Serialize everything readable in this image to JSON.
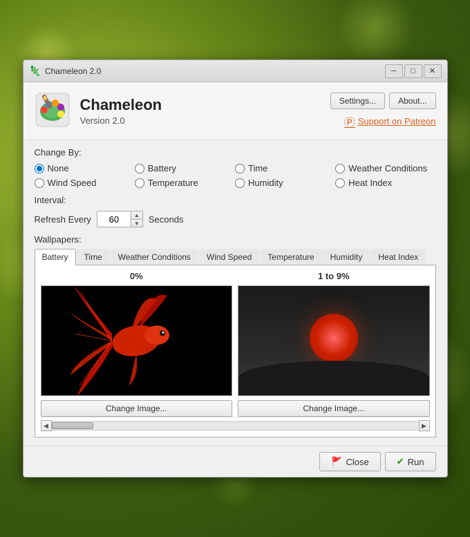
{
  "window": {
    "title": "Chameleon 2.0",
    "controls": {
      "minimize": "─",
      "maximize": "□",
      "close": "✕"
    }
  },
  "header": {
    "app_name": "Chameleon",
    "version": "Version 2.0",
    "settings_btn": "Settings...",
    "about_btn": "About...",
    "patreon_text": "Support on Patreon"
  },
  "change_by": {
    "label": "Change By:",
    "options": [
      {
        "id": "none",
        "label": "None",
        "checked": true
      },
      {
        "id": "battery",
        "label": "Battery",
        "checked": false
      },
      {
        "id": "time",
        "label": "Time",
        "checked": false
      },
      {
        "id": "weather",
        "label": "Weather Conditions",
        "checked": false
      },
      {
        "id": "wind",
        "label": "Wind Speed",
        "checked": false
      },
      {
        "id": "temperature",
        "label": "Temperature",
        "checked": false
      },
      {
        "id": "humidity",
        "label": "Humidity",
        "checked": false
      },
      {
        "id": "heat",
        "label": "Heat Index",
        "checked": false
      }
    ]
  },
  "interval": {
    "label": "Interval:",
    "refresh_label": "Refresh Every",
    "value": "60",
    "unit": "Seconds"
  },
  "wallpapers": {
    "label": "Wallpapers:",
    "tabs": [
      {
        "id": "battery",
        "label": "Battery",
        "active": true
      },
      {
        "id": "time",
        "label": "Time",
        "active": false
      },
      {
        "id": "weather",
        "label": "Weather Conditions",
        "active": false
      },
      {
        "id": "wind",
        "label": "Wind Speed",
        "active": false
      },
      {
        "id": "temperature",
        "label": "Temperature",
        "active": false
      },
      {
        "id": "humidity",
        "label": "Humidity",
        "active": false
      },
      {
        "id": "heat",
        "label": "Heat Index",
        "active": false
      }
    ],
    "cards": [
      {
        "title": "0%",
        "change_btn": "Change Image..."
      },
      {
        "title": "1 to 9%",
        "change_btn": "Change Image..."
      }
    ]
  },
  "footer": {
    "close_btn": "Close",
    "run_btn": "Run"
  }
}
